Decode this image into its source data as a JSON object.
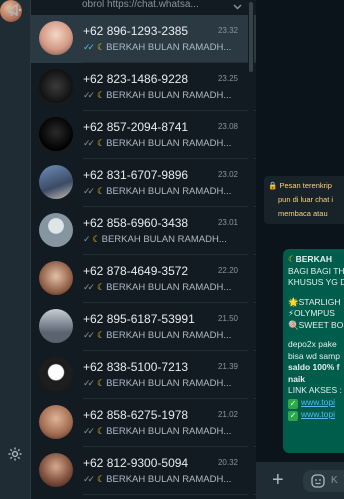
{
  "top_partial": {
    "preview": "obrol https://chat.whatsa..."
  },
  "chats": [
    {
      "name": "+62 896-1293-2385",
      "time": "23.32",
      "preview": "BERKAH BULAN RAMADH...",
      "ticks": "✓✓",
      "read": true
    },
    {
      "name": "+62 823-1486-9228",
      "time": "23.25",
      "preview": "BERKAH BULAN RAMADH...",
      "ticks": "✓✓",
      "read": false
    },
    {
      "name": "+62 857-2094-8741",
      "time": "23.08",
      "preview": "BERKAH BULAN RAMADH...",
      "ticks": "✓✓",
      "read": false
    },
    {
      "name": "+62 831-6707-9896",
      "time": "23.02",
      "preview": "BERKAH BULAN RAMADH...",
      "ticks": "✓✓",
      "read": false
    },
    {
      "name": "+62 858-6960-3438",
      "time": "23.01",
      "preview": "BERKAH BULAN RAMADH...",
      "ticks": "✓",
      "read": false
    },
    {
      "name": "+62 878-4649-3572",
      "time": "22.20",
      "preview": "BERKAH BULAN RAMADH...",
      "ticks": "✓✓",
      "read": false
    },
    {
      "name": "+62 895-6187-53991",
      "time": "21.50",
      "preview": "BERKAH BULAN RAMADH...",
      "ticks": "✓✓",
      "read": false
    },
    {
      "name": "+62 838-5100-7213",
      "time": "21.39",
      "preview": "BERKAH BULAN RAMADH...",
      "ticks": "✓✓",
      "read": false
    },
    {
      "name": "+62 858-6275-1978",
      "time": "21.02",
      "preview": "BERKAH BULAN RAMADH...",
      "ticks": "✓✓",
      "read": false
    },
    {
      "name": "+62 812-9300-5094",
      "time": "20.32",
      "preview": "BERKAH BULAN RAMADH...",
      "ticks": "✓✓",
      "read": false
    }
  ],
  "notice": {
    "line1": "Pesan terenkrip",
    "line2": "pun di luar chat i",
    "line3": "membaca atau"
  },
  "message": {
    "l1": "BERKAH",
    "l2": "BAGI BAGI TH",
    "l3": "KHUSUS YG D",
    "l4": "STARLIGH",
    "l5": "OLYMPUS",
    "l6": "SWEET BO",
    "l7": "depo2x pake",
    "l8": "bisa wd samp",
    "l9": "saldo 100% f",
    "l10": "naik",
    "l11": "LINK AKSES :",
    "link1": "www.topi",
    "link2": "www.topi"
  },
  "input": {
    "placeholder": "K"
  },
  "colors": {
    "accent_green": "#005c4b",
    "read_tick": "#53bdeb",
    "notice_yellow": "#ffd279"
  }
}
